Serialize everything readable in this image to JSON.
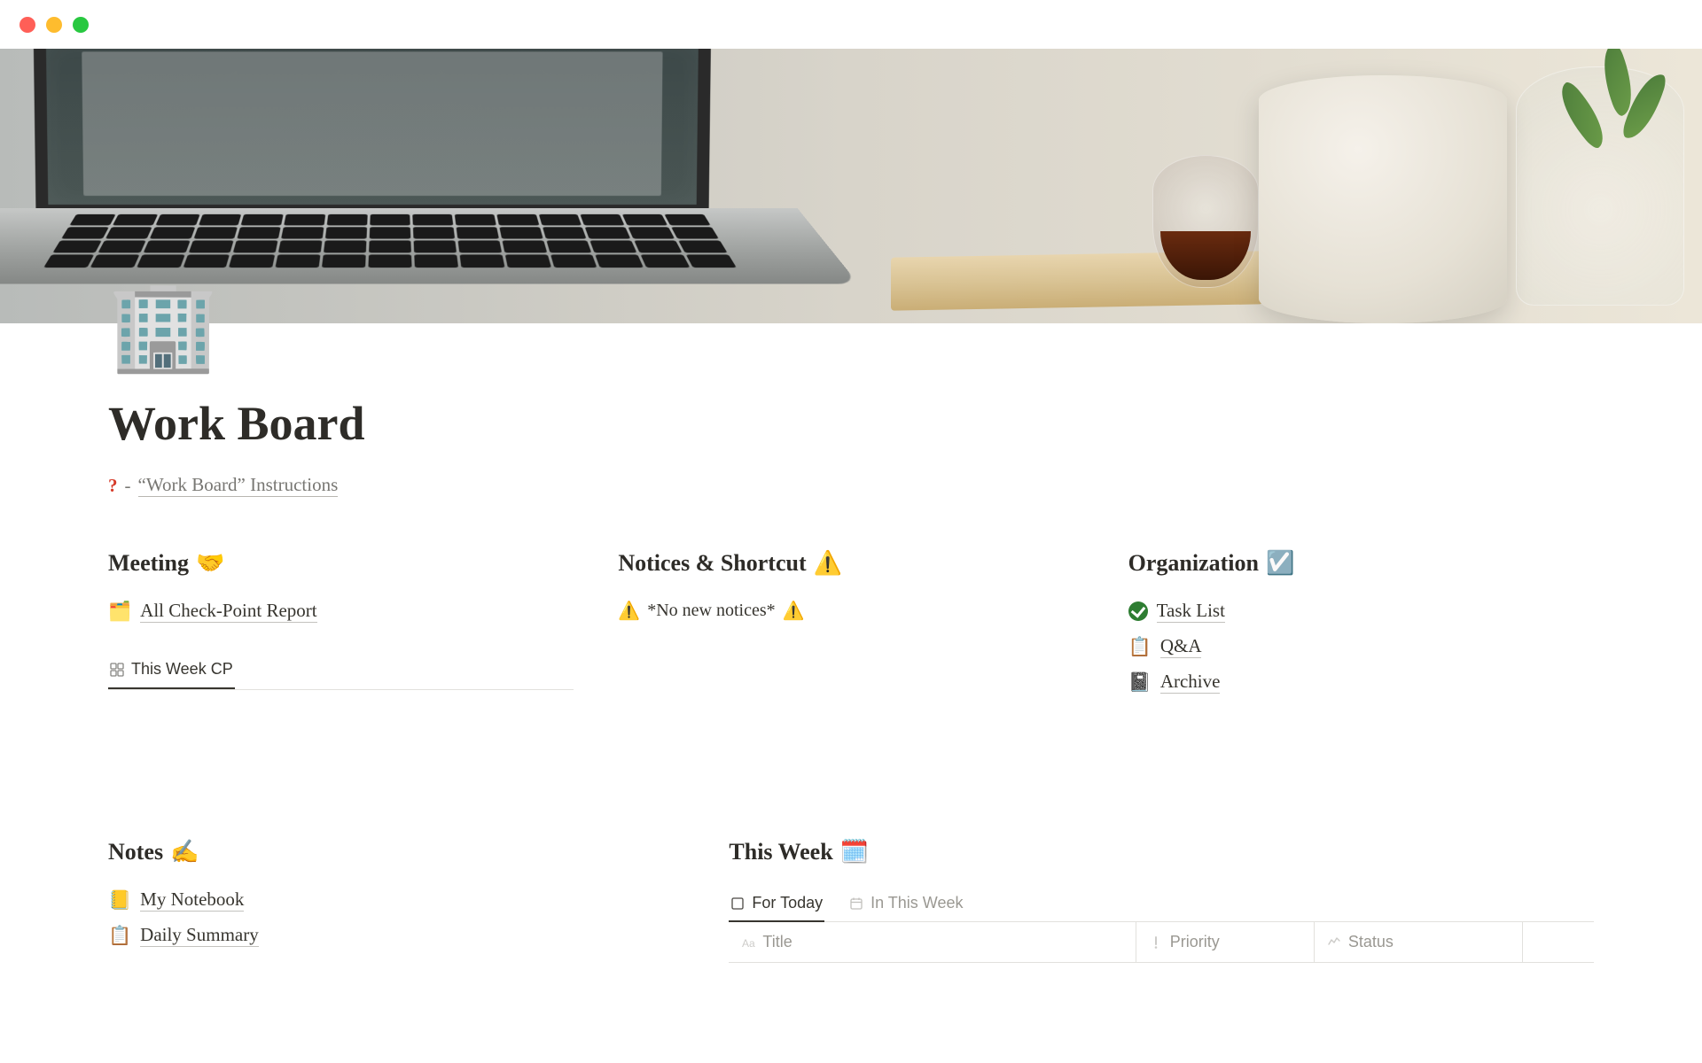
{
  "page": {
    "icon": "🏢",
    "title": "Work Board",
    "instructions_prefix": "?",
    "instructions_dash": "-",
    "instructions_label": "“Work Board” Instructions"
  },
  "meeting": {
    "heading": "Meeting",
    "heading_emoji": "🤝",
    "item1_icon": "🗂️",
    "item1_label": "All Check-Point Report",
    "tab_label": "This Week CP"
  },
  "notices": {
    "heading": "Notices & Shortcut",
    "heading_emoji": "⚠️",
    "warn_left": "⚠️",
    "text": "*No new notices*",
    "warn_right": "⚠️"
  },
  "organization": {
    "heading": "Organization",
    "heading_emoji": "☑️",
    "item1_label": "Task List",
    "item2_icon": "📋",
    "item2_label": "Q&A",
    "item3_icon": "📓",
    "item3_label": "Archive"
  },
  "notes": {
    "heading": "Notes",
    "heading_emoji": "✍️",
    "item1_icon": "📒",
    "item1_label": "My Notebook",
    "item2_icon": "📋",
    "item2_label": "Daily Summary"
  },
  "thisweek": {
    "heading": "This Week",
    "heading_emoji": "🗓️",
    "tab1": "For Today",
    "tab2": "In This Week",
    "col_title": "Title",
    "col_priority": "Priority",
    "col_status": "Status"
  }
}
